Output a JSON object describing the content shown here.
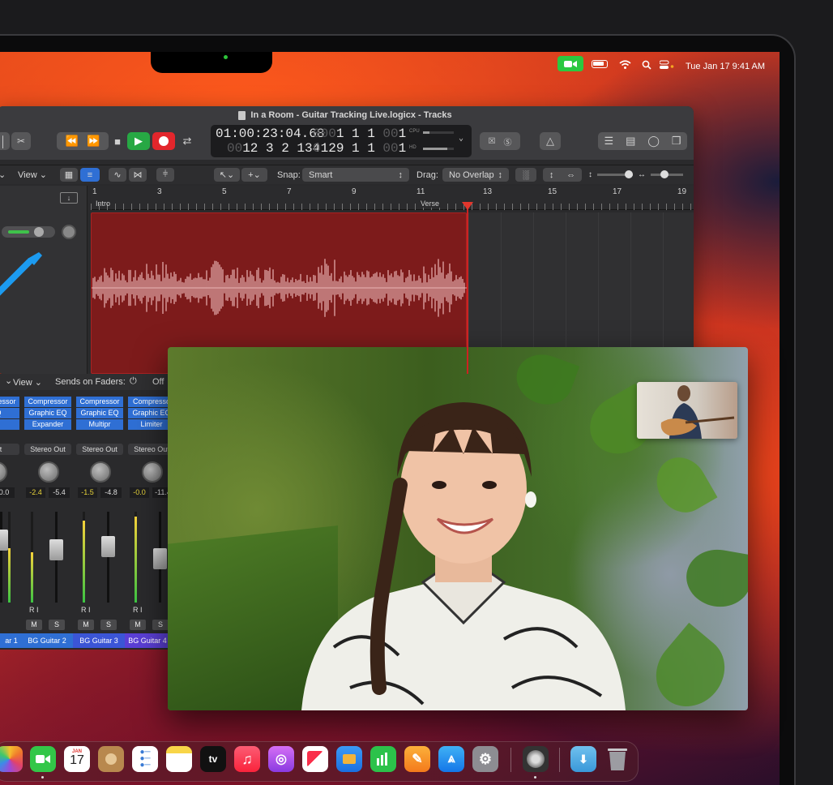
{
  "menubar": {
    "clock": "Tue Jan 17  9:41 AM",
    "icons": [
      "facetime-video-icon",
      "battery-icon",
      "wifi-icon",
      "search-icon",
      "control-center-icon"
    ]
  },
  "logic": {
    "title": "In a Room - Guitar Tracking Live.logicx - Tracks",
    "lcd": {
      "time_top": "01:00:23:04.68",
      "time_bottom_dim": "00",
      "time_bottom": "12  3  2  134",
      "bars_top_dim": "000",
      "bars_top": "1  1  1  ",
      "bars_top_tail_dim": "00",
      "bars_top_tail": "1",
      "bars_bottom_dim": "0",
      "bars_bottom": "129  1  1  ",
      "bars_bottom_tail_dim": "00",
      "bars_bottom_tail": "1",
      "cpu_label": "CPU",
      "hd_label": "HD"
    },
    "controls": {
      "view_label": "View",
      "snap_label": "Snap:",
      "snap_value": "Smart",
      "drag_label": "Drag:",
      "drag_value": "No Overlap"
    },
    "ruler": {
      "numbers": [
        "1",
        "3",
        "5",
        "7",
        "9",
        "11",
        "13",
        "15",
        "17",
        "19"
      ],
      "markers": [
        "Intro",
        "Verse"
      ]
    }
  },
  "mixer": {
    "view_label": "View",
    "sends_label": "Sends on Faders:",
    "sends_value": "Off",
    "strips": [
      {
        "plugins": [
          "Compressor",
          "EQ",
          "r 2"
        ],
        "output": "Out",
        "gain": [
          "0.0"
        ],
        "name": "ar 1",
        "meter": 0.6,
        "fader": 0.75
      },
      {
        "plugins": [
          "Compressor",
          "Graphic EQ",
          "Expander"
        ],
        "output": "Stereo Out",
        "gain": [
          "-2.4",
          "-5.4"
        ],
        "name": "BG Guitar 2",
        "meter": 0.55,
        "fader": 0.6
      },
      {
        "plugins": [
          "Compressor",
          "Graphic EQ",
          "Multipr"
        ],
        "output": "Stereo Out",
        "gain": [
          "-1.5",
          "-4.8"
        ],
        "name": "BG Guitar 3",
        "meter": 0.9,
        "fader": 0.65
      },
      {
        "plugins": [
          "Compresso",
          "Graphic EQ",
          "Limiter"
        ],
        "output": "Stereo Out",
        "gain": [
          "-0.0",
          "-11.4"
        ],
        "name": "BG Guitar 4",
        "meter": 0.95,
        "fader": 0.48
      }
    ],
    "ri_label": "R I",
    "m_label": "M",
    "s_label": "S"
  },
  "dock": {
    "calendar_month": "JAN",
    "calendar_day": "17",
    "tv_label": "tv",
    "icons": [
      "photos-icon",
      "facetime-icon",
      "calendar-icon",
      "contacts-icon",
      "reminders-icon",
      "notes-icon",
      "apple-tv-icon",
      "music-icon",
      "podcasts-icon",
      "news-icon",
      "keynote-icon",
      "numbers-icon",
      "pages-icon",
      "app-store-icon",
      "system-settings-icon",
      "logic-pro-icon",
      "downloads-folder-icon",
      "trash-icon"
    ]
  },
  "colors": {
    "facetime_green": "#2bc840",
    "region_red": "#7d1b1b",
    "plugin_blue": "#2f6fd4",
    "play_green": "#27a844",
    "record_red": "#e3262c"
  }
}
